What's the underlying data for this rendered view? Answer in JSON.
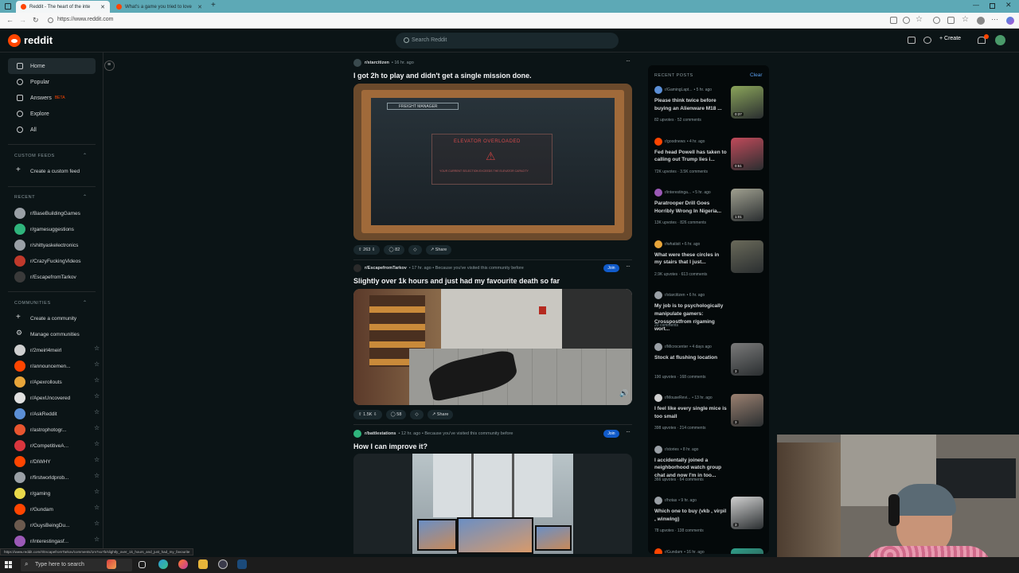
{
  "browser": {
    "tabs": [
      {
        "title": "Reddit - The heart of the inte",
        "active": true
      },
      {
        "title": "What's a game you tried to love",
        "active": false
      }
    ],
    "url": "https://www.reddit.com",
    "status_link": "https://www.reddit.com/r/EscapefromTarkov/comments/1m7xu7b/slightly_over_1k_hours_and_just_had_my_favourite"
  },
  "header": {
    "logo_text": "reddit",
    "search_placeholder": "Search Reddit",
    "create_label": "+ Create"
  },
  "sidebar": {
    "nav": [
      {
        "label": "Home",
        "icon": "home-icon",
        "active": true
      },
      {
        "label": "Popular",
        "icon": "popular-icon",
        "active": false
      },
      {
        "label": "Answers",
        "icon": "answers-icon",
        "badge": "BETA",
        "active": false
      },
      {
        "label": "Explore",
        "icon": "explore-icon",
        "active": false
      },
      {
        "label": "All",
        "icon": "all-icon",
        "active": false
      }
    ],
    "custom_feeds_heading": "CUSTOM FEEDS",
    "create_custom_feed": "Create a custom feed",
    "recent_heading": "RECENT",
    "recent": [
      {
        "name": "r/BaseBuildingGames",
        "color": "#9aa0a6"
      },
      {
        "name": "r/gamesuggestions",
        "color": "#2fb47c"
      },
      {
        "name": "r/shittyaskelectronics",
        "color": "#9aa0a6"
      },
      {
        "name": "r/CrazyFuckingVideos",
        "color": "#c0392b"
      },
      {
        "name": "r/EscapefromTarkov",
        "color": "#3a3a3a"
      }
    ],
    "communities_heading": "COMMUNITIES",
    "create_community": "Create a community",
    "manage_communities": "Manage communities",
    "communities": [
      {
        "name": "r/2meirl4meirl",
        "color": "#cfcfcf"
      },
      {
        "name": "r/announcemen...",
        "color": "#ff4500"
      },
      {
        "name": "r/Apexrollouts",
        "color": "#e8a53a"
      },
      {
        "name": "r/ApexUncovered",
        "color": "#e0e0e0"
      },
      {
        "name": "r/AskReddit",
        "color": "#5b8fd6"
      },
      {
        "name": "r/astrophotogr...",
        "color": "#e8552f"
      },
      {
        "name": "r/CompetitiveA...",
        "color": "#d9363e"
      },
      {
        "name": "r/DIWHY",
        "color": "#ff4500"
      },
      {
        "name": "r/firstworldprob...",
        "color": "#9aa0a6"
      },
      {
        "name": "r/gaming",
        "color": "#e9d94a"
      },
      {
        "name": "r/Gundam",
        "color": "#ff4500"
      },
      {
        "name": "r/GuysBeingDu...",
        "color": "#6b5a4e"
      },
      {
        "name": "r/interestingasf...",
        "color": "#9b59b6"
      }
    ]
  },
  "feed": {
    "posts": [
      {
        "subreddit": "r/starcitizen",
        "meta": "• 16 hr. ago",
        "title": "I got 2h to play and didn't get a single mission done.",
        "upvotes": "263",
        "comments": "82",
        "share": "Share",
        "overlay_title": "FREIGHT MANAGER",
        "overlay_warning": "ELEVATOR OVERLOADED",
        "overlay_detail": "YOUR CURRENT SELECTION EXCEEDS THE ELEVATOR CAPACITY"
      },
      {
        "subreddit": "r/EscapefromTarkov",
        "meta": "• 17 hr. ago • Because you've visited this community before",
        "title": "Slightly over 1k hours and just had my favourite death so far",
        "join": "Join",
        "upvotes": "1.5K",
        "comments": "58",
        "share": "Share"
      },
      {
        "subreddit": "r/battlestations",
        "meta": "• 12 hr. ago • Because you've visited this community before",
        "title": "How I can improve it?",
        "join": "Join"
      }
    ]
  },
  "recent_panel": {
    "heading": "RECENT POSTS",
    "clear": "Clear",
    "items": [
      {
        "sub": "r/GamingLapt...",
        "age": "• 5 hr. ago",
        "title": "Please think twice before buying an Alienware M18 ...",
        "stats": "82 upvotes · 52 comments",
        "duration": "0:37",
        "color": "#5b8fd6"
      },
      {
        "sub": "r/goodnews",
        "age": "• 4 hr. ago",
        "title": "Fed head Powell has taken to calling out Trump lies i...",
        "stats": "72K upvotes · 3.5K comments",
        "duration": "0:51",
        "color": "#ff4500"
      },
      {
        "sub": "r/interestinga...",
        "age": "• 5 hr. ago",
        "title": "Paratrooper Drill Goes Horribly Wrong In Nigeria...",
        "stats": "13K upvotes · 826 comments",
        "duration": "1:01",
        "color": "#9b59b6"
      },
      {
        "sub": "r/whatisit",
        "age": "• 6 hr. ago",
        "title": "What were these circles in my stairs that I just...",
        "stats": "2.9K upvotes · 613 comments",
        "color": "#e8a53a"
      },
      {
        "sub": "r/starcitizen",
        "age": "• 6 hr. ago",
        "title": "My job is to psychologically manipulate gamers: Crosspostfrom r/gaming wort...",
        "stats": "20 comments",
        "color": "#9aa0a6"
      },
      {
        "sub": "r/Microcenter",
        "age": "• 4 days ago",
        "title": "Stock at flushing location",
        "stats": "190 upvotes · 168 comments",
        "duration": "3",
        "color": "#9aa0a6"
      },
      {
        "sub": "r/MouseRevi...",
        "age": "• 13 hr. ago",
        "title": "I feel like every single mice is too small",
        "stats": "398 upvotes · 214 comments",
        "duration": "3",
        "color": "#cfcfcf"
      },
      {
        "sub": "r/stories",
        "age": "• 8 hr. ago",
        "title": "I accidentally joined a neighborhood watch group chat and now I'm in too...",
        "stats": "366 upvotes · 64 comments",
        "color": "#9aa0a6"
      },
      {
        "sub": "r/hotas",
        "age": "• 9 hr. ago",
        "title": "Which one to buy (vkb , virpil , winwing)",
        "stats": "78 upvotes · 138 comments",
        "duration": "3",
        "color": "#9aa0a6"
      },
      {
        "sub": "r/Gundam",
        "age": "• 16 hr. ago",
        "title": "",
        "stats": "",
        "color": "#ff4500"
      }
    ]
  },
  "taskbar": {
    "search_placeholder": "Type here to search"
  }
}
